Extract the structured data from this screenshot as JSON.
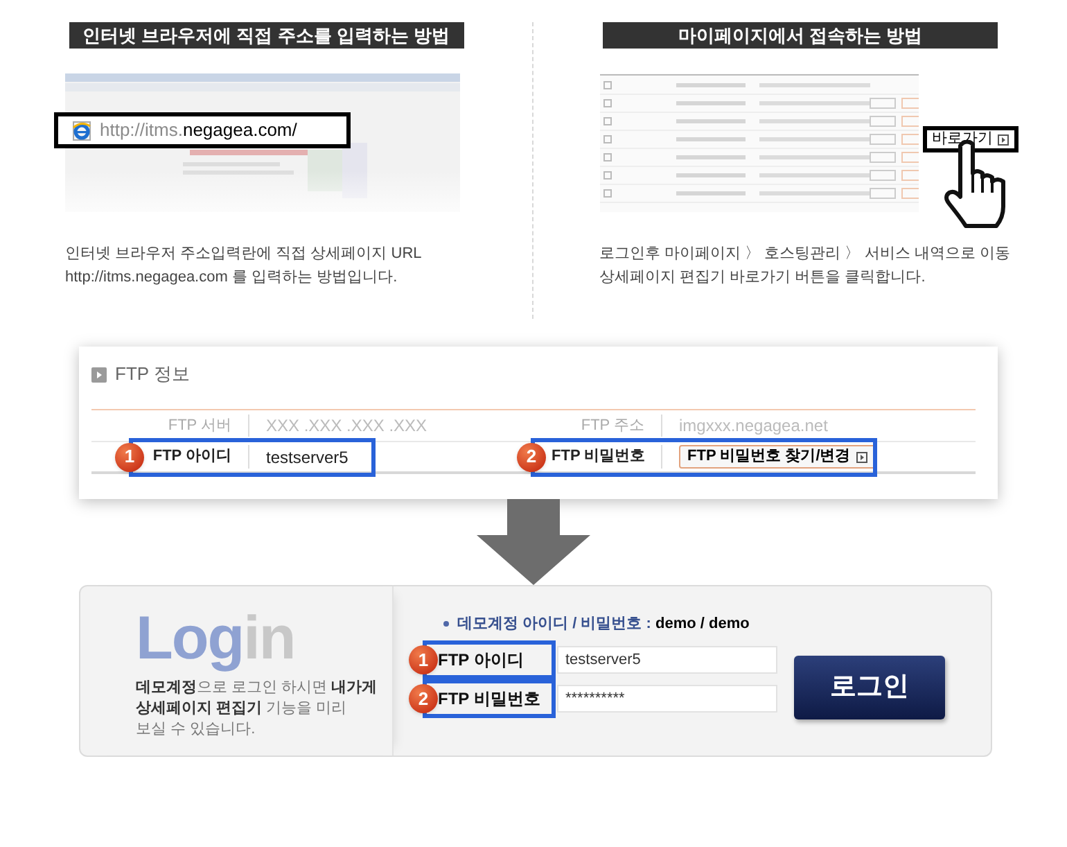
{
  "methods": [
    {
      "kind": "browser",
      "title": "인터넷 브라우저에 직접 주소를 입력하는 방법",
      "url_parts": [
        "http://itms.",
        "negagea.com/"
      ],
      "description": "인터넷 브라우저 주소입력란에 직접 상세페이지 URL\nhttp://itms.negagea.com 를 입력하는 방법입니다."
    },
    {
      "kind": "mypage",
      "title": "마이페이지에서 접속하는 방법",
      "callout": "바로가기",
      "description": "로그인후 마이페이지 〉 호스팅관리 〉 서비스 내역으로 이동\n상세페이지 편집기 바로가기 버튼을 클릭합니다."
    }
  ],
  "ftp_panel": {
    "title": "FTP 정보",
    "rows": [
      {
        "fields": [
          {
            "label": "FTP 서버",
            "value": "XXX .XXX .XXX .XXX",
            "kind": "text",
            "highlighted": false
          },
          {
            "label": "FTP 주소",
            "value": "imgxxx.negagea.net",
            "kind": "text",
            "highlighted": false
          }
        ]
      },
      {
        "fields": [
          {
            "badge": "1",
            "label": "FTP 아이디",
            "value": "testserver5",
            "kind": "text",
            "highlighted": true
          },
          {
            "badge": "2",
            "label": "FTP 비밀번호",
            "value": "FTP 비밀번호 찾기/변경",
            "kind": "button",
            "highlighted": true
          }
        ]
      }
    ]
  },
  "login_panel": {
    "title_parts": [
      {
        "text": "Log",
        "color": "#8fa2d2"
      },
      {
        "text": "in",
        "color": "#c8c8c8"
      }
    ],
    "description": "**데모계정**으로 로그인 하시면 **내가게**\n**상세페이지 편집기** 기능을 미리\n보실 수 있습니다.",
    "demo_label": "데모계정 아이디 / 비밀번호 :",
    "demo_value": "demo / demo",
    "fields": [
      {
        "badge": "1",
        "label": "FTP 아이디",
        "value": "testserver5",
        "highlighted": true
      },
      {
        "badge": "2",
        "label": "FTP 비밀번호",
        "value": "**********",
        "highlighted": true
      }
    ],
    "button": "로그인"
  }
}
